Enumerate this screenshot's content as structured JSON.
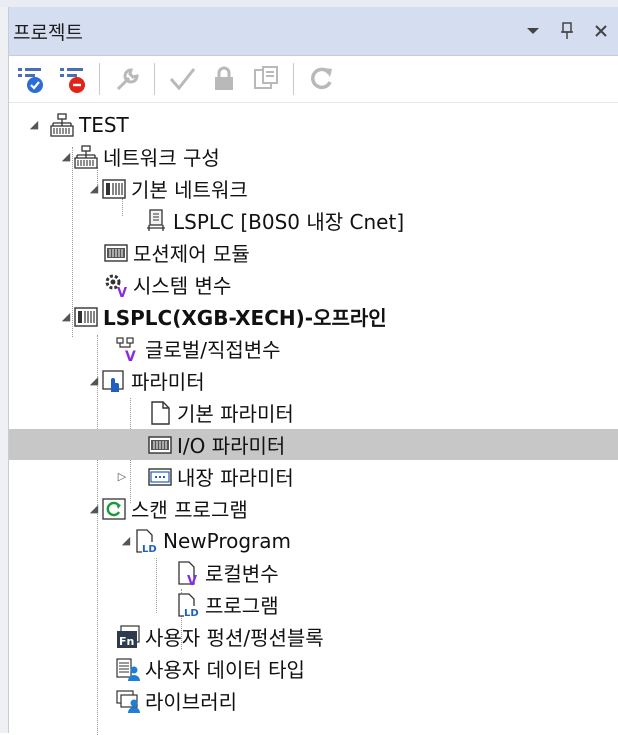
{
  "panel": {
    "title": "프로젝트",
    "dropdown_icon": "chevron-down-icon",
    "pin_icon": "pin-icon",
    "close_icon": "close-icon"
  },
  "toolbar": {
    "items": [
      {
        "name": "connect-icon"
      },
      {
        "name": "disconnect-icon"
      },
      {
        "name": "wrench-icon"
      },
      {
        "name": "check-icon"
      },
      {
        "name": "lock-icon"
      },
      {
        "name": "window-icon"
      },
      {
        "name": "refresh-icon"
      }
    ]
  },
  "tree": {
    "items": [
      {
        "label": "TEST"
      },
      {
        "label": "네트워크 구성"
      },
      {
        "label": "기본 네트워크"
      },
      {
        "label": "LSPLC [B0S0 내장 Cnet]"
      },
      {
        "label": "모션제어 모듈"
      },
      {
        "label": "시스템 변수"
      },
      {
        "label": "LSPLC(XGB-XECH)-오프라인"
      },
      {
        "label": "글로벌/직접변수"
      },
      {
        "label": "파라미터"
      },
      {
        "label": "기본 파라미터"
      },
      {
        "label": "I/O 파라미터"
      },
      {
        "label": "내장 파라미터"
      },
      {
        "label": "스캔 프로그램"
      },
      {
        "label": "NewProgram"
      },
      {
        "label": "로컬변수"
      },
      {
        "label": "프로그램"
      },
      {
        "label": "사용자 펑션/펑션블록"
      },
      {
        "label": "사용자 데이터 타입"
      },
      {
        "label": "라이브러리"
      }
    ]
  },
  "colors": {
    "titlebar": "#d5ddf0",
    "selection": "#c7c7c7",
    "accent_blue": "#2b6cd6",
    "accent_red": "#e2231a",
    "purple": "#8a2be2"
  }
}
